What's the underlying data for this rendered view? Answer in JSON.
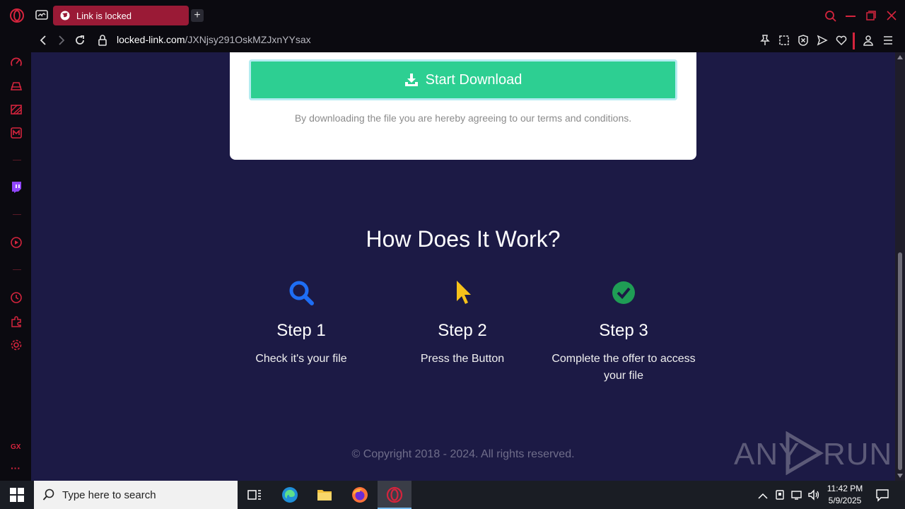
{
  "browser": {
    "tab_title": "Link is locked",
    "url_host": "locked-link.com",
    "url_path": "/JXNjsy291OskMZJxnYYsax"
  },
  "page": {
    "download_button_label": "Start Download",
    "terms_text": "By downloading the file you are hereby agreeing to our terms and conditions.",
    "how_title": "How Does It Work?",
    "steps": [
      {
        "title": "Step 1",
        "desc": "Check it's your file",
        "icon": "search-icon",
        "color": "#1e6ef5"
      },
      {
        "title": "Step 2",
        "desc": "Press the Button",
        "icon": "cursor-icon",
        "color": "#f6c21a"
      },
      {
        "title": "Step 3",
        "desc": "Complete the offer to access your file",
        "icon": "check-circle-icon",
        "color": "#1f9d55"
      }
    ],
    "copyright": "© Copyright 2018 - 2024. All rights reserved."
  },
  "sidebar": {
    "gx_label": "GX",
    "more_label": "···"
  },
  "watermark": {
    "text_left": "ANY",
    "text_right": "RUN"
  },
  "taskbar": {
    "search_placeholder": "Type here to search",
    "time": "11:42 PM",
    "date": "5/9/2025"
  },
  "colors": {
    "accent": "#d5243d",
    "content_bg": "#1c1a45",
    "download_green": "#2dcf92"
  }
}
